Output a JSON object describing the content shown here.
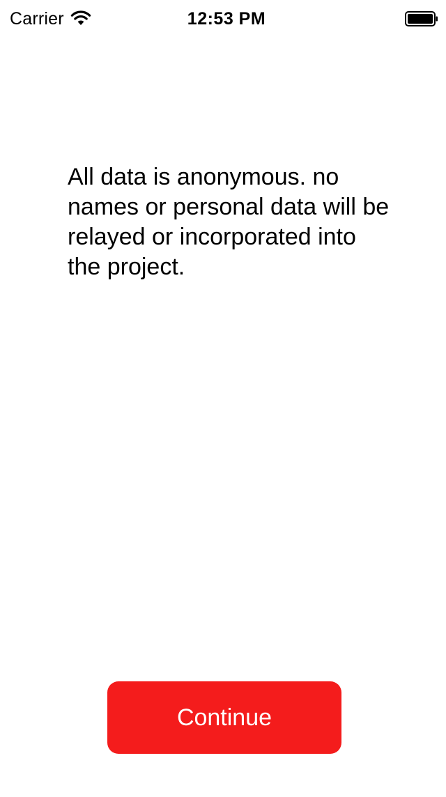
{
  "status_bar": {
    "carrier": "Carrier",
    "time": "12:53 PM",
    "wifi_icon": "wifi-icon",
    "battery_icon": "battery-icon"
  },
  "main": {
    "message": "All data is anonymous. no names or personal data will be relayed or incorporated into the project.",
    "continue_label": "Continue"
  },
  "colors": {
    "background": "#ffffff",
    "button": "#f41c1c",
    "button_text": "#ffffff",
    "text": "#000000"
  }
}
